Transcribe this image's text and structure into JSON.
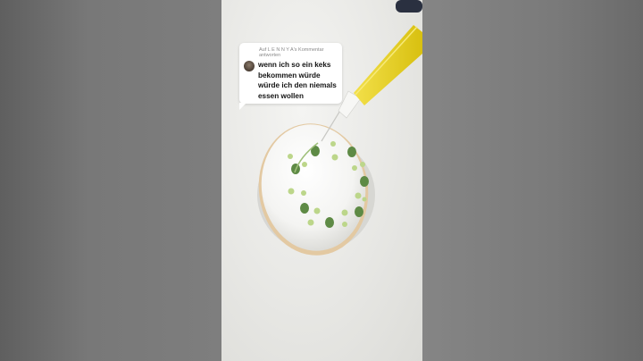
{
  "reply_card": {
    "header": "Auf L E N N Y A's Kommentar antworten",
    "comment": "wenn ich so ein keks bekommen würde würde ich den niemals essen wollen"
  },
  "colors": {
    "card_background": "#ffffff",
    "icing": "#f6f6f4",
    "dot_dark_green": "#5e8a45",
    "dot_light_green": "#bcd68a",
    "tool_yellow": "#e8d21e"
  },
  "icons": {
    "avatar": "commenter-avatar"
  }
}
